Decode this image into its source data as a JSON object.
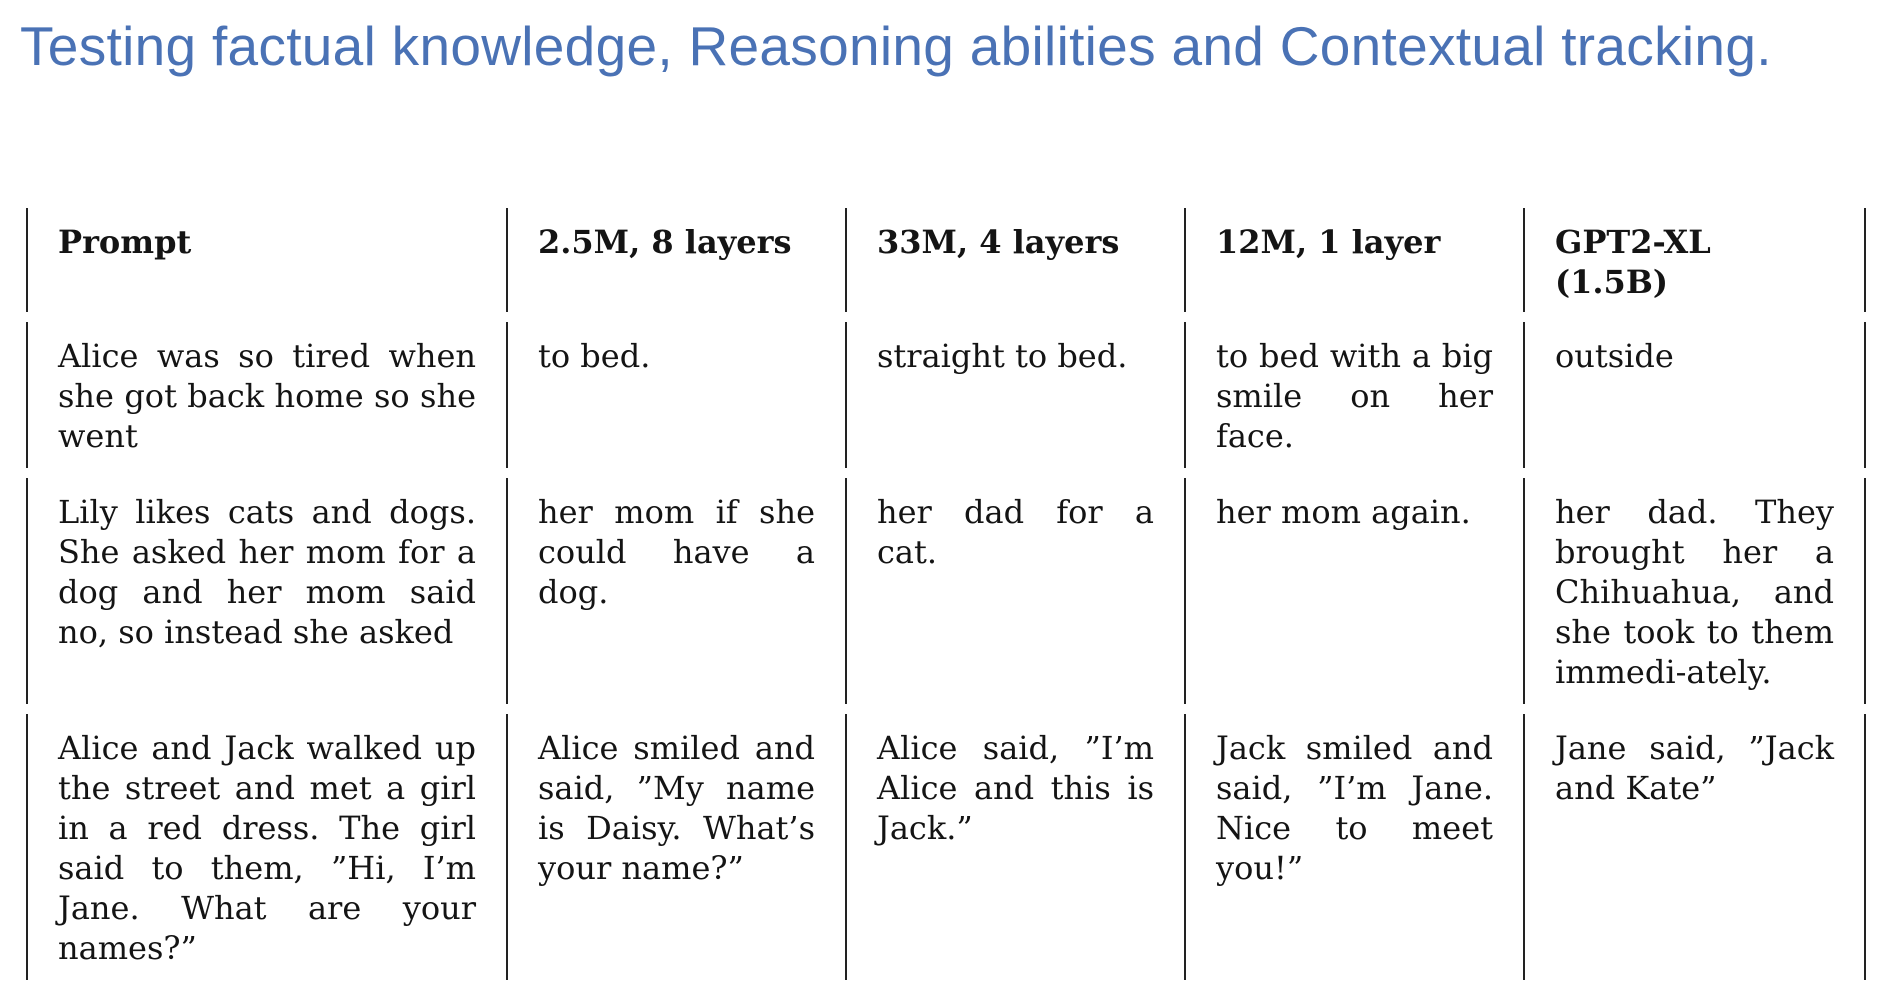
{
  "title": "Testing factual knowledge, Reasoning abilities and Contextual tracking.",
  "table": {
    "headers": [
      "Prompt",
      "2.5M, 8 layers",
      "33M, 4 layers",
      "12M, 1 layer",
      "GPT2-XL (1.5B)"
    ],
    "rows": [
      [
        "Alice was so tired when she got back home so she went",
        "to bed.",
        "straight to bed.",
        "to bed with a big smile on her face.",
        "outside"
      ],
      [
        "Lily likes cats and dogs. She asked her mom for a dog and her mom said no, so instead she asked",
        "her mom if she could have a dog.",
        "her dad for a cat.",
        "her mom again.",
        "her dad. They brought her a Chihuahua, and she took to them immedi-ately."
      ],
      [
        "Alice and Jack walked up the street and met a girl in a red dress. The girl said to them, ”Hi, I’m Jane. What are your names?”",
        "Alice smiled and said, ”My name is Daisy. What’s your name?”",
        "Alice said, ”I’m Alice and this is Jack.”",
        "Jack smiled and said, ”I’m Jane. Nice to meet you!”",
        "Jane said, ”Jack and Kate”"
      ]
    ]
  }
}
